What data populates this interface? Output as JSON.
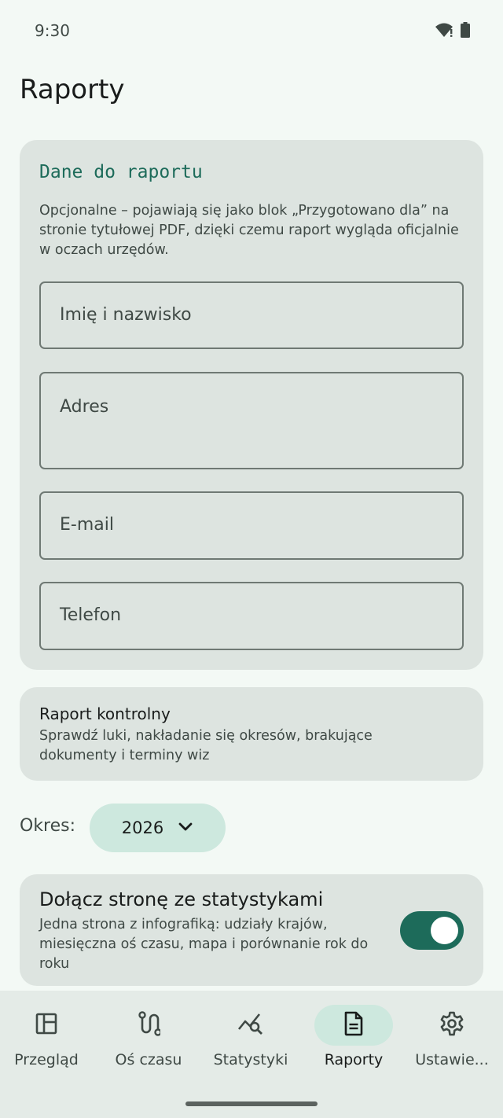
{
  "status_bar": {
    "time": "9:30",
    "icons": [
      "wifi-warning-icon",
      "battery-icon"
    ]
  },
  "page": {
    "title": "Raporty"
  },
  "report_details": {
    "title": "Dane do raportu",
    "description": "Opcjonalne – pojawiają się jako blok „Przygotowano dla” na stronie tytułowej PDF, dzięki czemu raport wygląda oficjalnie w oczach urzędów.",
    "fields": {
      "name_placeholder": "Imię i nazwisko",
      "address_placeholder": "Adres",
      "email_placeholder": "E-mail",
      "phone_placeholder": "Telefon"
    }
  },
  "control_report": {
    "title": "Raport kontrolny",
    "description": "Sprawdź luki, nakładanie się okresów, brakujące dokumenty i terminy wiz"
  },
  "period": {
    "label": "Okres:",
    "selected": "2026"
  },
  "stats_page": {
    "title": "Dołącz stronę ze statystykami",
    "description": "Jedna strona z infografiką: udziały krajów, miesięczna oś czasu, mapa i porównanie rok do roku",
    "enabled": true
  },
  "nav": {
    "items": [
      {
        "label": "Przegląd",
        "icon": "dashboard-icon",
        "active": false
      },
      {
        "label": "Oś czasu",
        "icon": "timeline-icon",
        "active": false
      },
      {
        "label": "Statystyki",
        "icon": "query-stats-icon",
        "active": false
      },
      {
        "label": "Raporty",
        "icon": "description-icon",
        "active": true
      },
      {
        "label": "Ustawie...",
        "icon": "settings-icon",
        "active": false
      }
    ]
  },
  "colors": {
    "background": "#f3f9f5",
    "card": "#dde4e0",
    "accent": "#1d6b5a",
    "chip": "#cde8de"
  }
}
